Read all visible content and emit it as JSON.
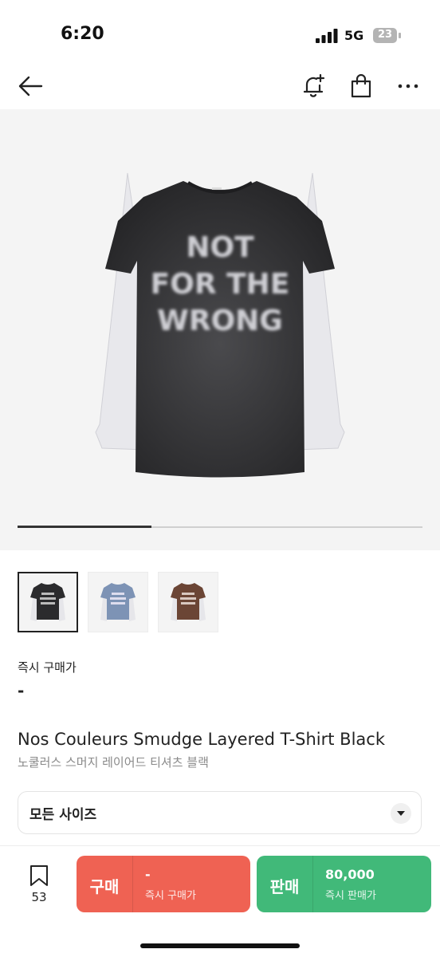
{
  "status_bar": {
    "time": "6:20",
    "network": "5G",
    "battery": "23"
  },
  "nav": {
    "icons": [
      "back-arrow-icon",
      "bell-plus-icon",
      "shopping-bag-icon",
      "more-horizontal-icon"
    ]
  },
  "product_image": {
    "graphic_text": "NOT FOR THE WRONG",
    "carousel_progress": 0.33
  },
  "thumbnails": [
    {
      "variant": "black",
      "shirt_color": "#2b2b2d",
      "selected": true
    },
    {
      "variant": "blue",
      "shirt_color": "#7d93b5",
      "selected": false
    },
    {
      "variant": "brown",
      "shirt_color": "#6b4535",
      "selected": false
    }
  ],
  "price": {
    "label": "즉시 구매가",
    "value": "-"
  },
  "product": {
    "name": "Nos Couleurs Smudge Layered T-Shirt Black",
    "name_ko": "노쿨러스 스머지 레이어드 티셔츠 블랙"
  },
  "size_select": {
    "label": "모든 사이즈"
  },
  "bottom_bar": {
    "bookmark_count": "53",
    "buy": {
      "label": "구매",
      "price": "-",
      "sub": "즉시 구매가",
      "color": "#ef6253"
    },
    "sell": {
      "label": "판매",
      "price": "80,000",
      "sub": "즉시 판매가",
      "color": "#41b979"
    }
  }
}
